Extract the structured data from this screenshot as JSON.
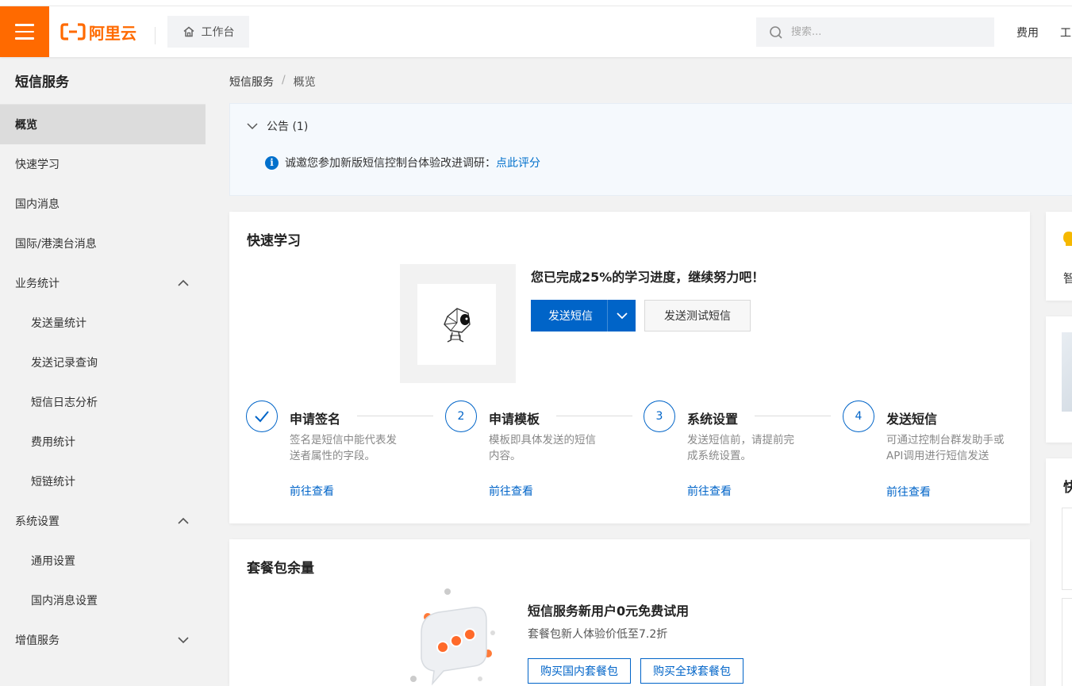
{
  "header": {
    "brand": "阿里云",
    "workbench_label": "工作台",
    "search_placeholder": "搜索...",
    "links": [
      "费用",
      "工"
    ]
  },
  "sidebar": {
    "title": "短信服务",
    "items": [
      {
        "label": "概览",
        "active": true
      },
      {
        "label": "快速学习"
      },
      {
        "label": "国内消息"
      },
      {
        "label": "国际/港澳台消息"
      },
      {
        "label": "业务统计",
        "expanded": true
      },
      {
        "label": "发送量统计",
        "sub": true
      },
      {
        "label": "发送记录查询",
        "sub": true
      },
      {
        "label": "短信日志分析",
        "sub": true
      },
      {
        "label": "费用统计",
        "sub": true
      },
      {
        "label": "短链统计",
        "sub": true
      },
      {
        "label": "系统设置",
        "expanded": true
      },
      {
        "label": "通用设置",
        "sub": true
      },
      {
        "label": "国内消息设置",
        "sub": true
      },
      {
        "label": "增值服务",
        "expanded": false
      }
    ]
  },
  "breadcrumb": {
    "root": "短信服务",
    "separator": "/",
    "current": "概览"
  },
  "notice": {
    "header": "公告 (1)",
    "text": "诚邀您参加新版短信控制台体验改进调研：",
    "link": "点此评分"
  },
  "quick_learn": {
    "title": "快速学习",
    "progress_text": "您已完成25%的学习进度，继续努力吧！",
    "progress_percent": 25,
    "primary_button": "发送短信",
    "secondary_button": "发送测试短信",
    "steps": [
      {
        "marker": "✓",
        "done": true,
        "title": "申请签名",
        "desc": "签名是短信中能代表发送者属性的字段。",
        "link": "前往查看"
      },
      {
        "marker": "2",
        "title": "申请模板",
        "desc": "模板即具体发送的短信内容。",
        "link": "前往查看"
      },
      {
        "marker": "3",
        "title": "系统设置",
        "desc": "发送短信前，请提前完成系统设置。",
        "link": "前往查看"
      },
      {
        "marker": "4",
        "title": "发送短信",
        "desc": "可通过控制台群发助手或API调用进行短信发送",
        "link": "前往查看"
      }
    ]
  },
  "package": {
    "title": "套餐包余量",
    "promo_title": "短信服务新用户0元免费试用",
    "promo_sub": "套餐包新人体验价低至7.2折",
    "buttons": [
      "购买国内套餐包",
      "购买全球套餐包"
    ]
  },
  "right_panel": {
    "card1_text": "智",
    "card3_text": "快"
  },
  "colors": {
    "brand_orange": "#ff6a00",
    "primary_blue": "#0064c8",
    "active_bg": "#dcdcdc"
  }
}
